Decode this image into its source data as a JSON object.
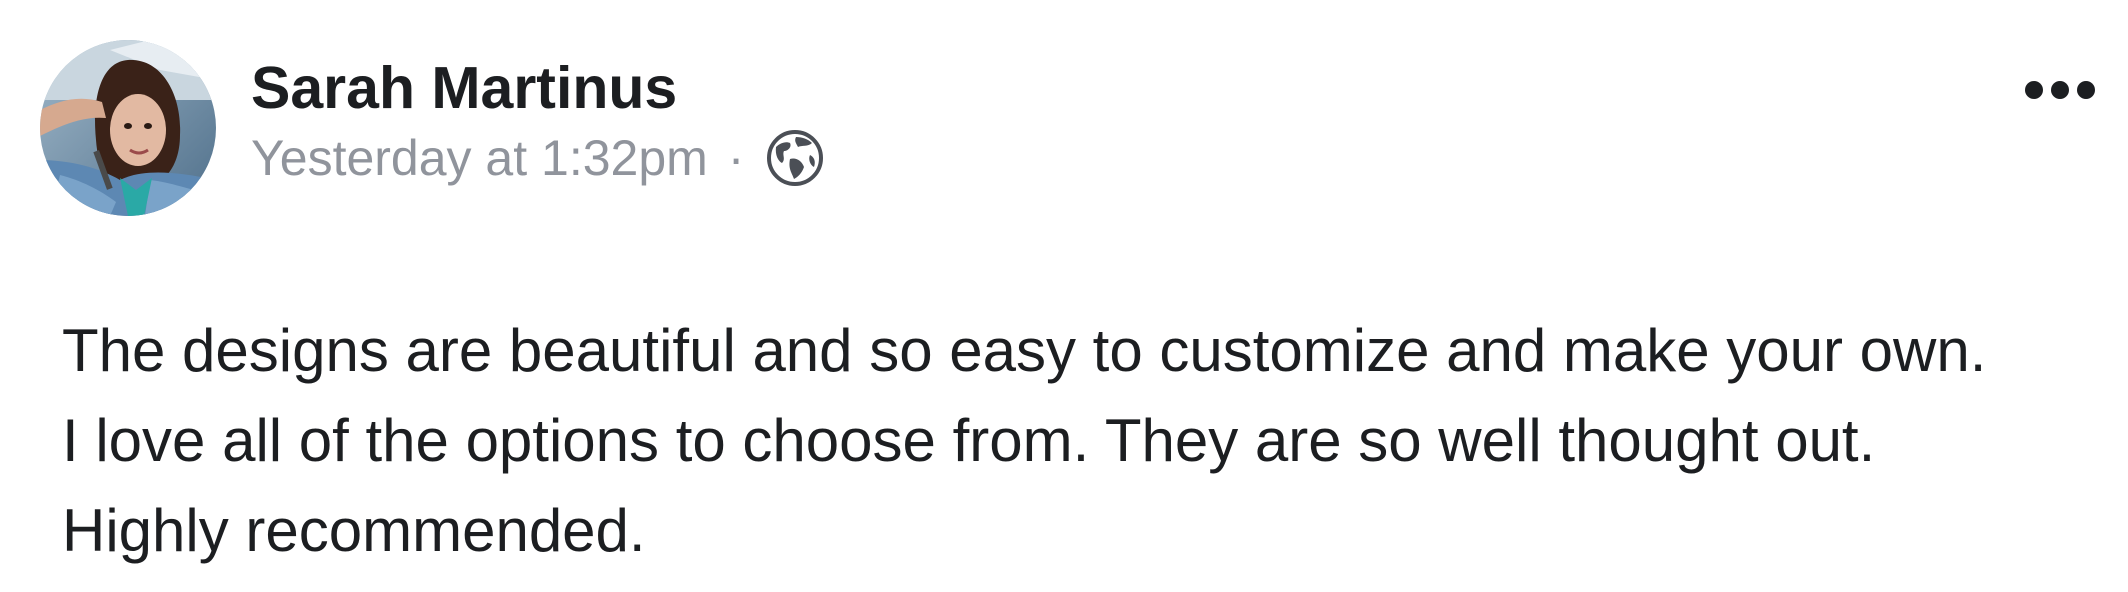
{
  "post": {
    "author": {
      "name": "Sarah Martinus",
      "avatar_icon": "profile-photo"
    },
    "meta": {
      "timestamp": "Yesterday at 1:32pm",
      "separator": "·",
      "audience_icon": "globe-icon",
      "audience": "Public"
    },
    "more_icon": "more-dots-icon",
    "body_lines": [
      "The designs are beautiful and so easy to customize and make your own.",
      "I love all of the options to choose from. They are so well thought out.",
      "Highly recommended."
    ]
  },
  "colors": {
    "text_primary": "#1c1e21",
    "text_secondary": "#90949c"
  }
}
